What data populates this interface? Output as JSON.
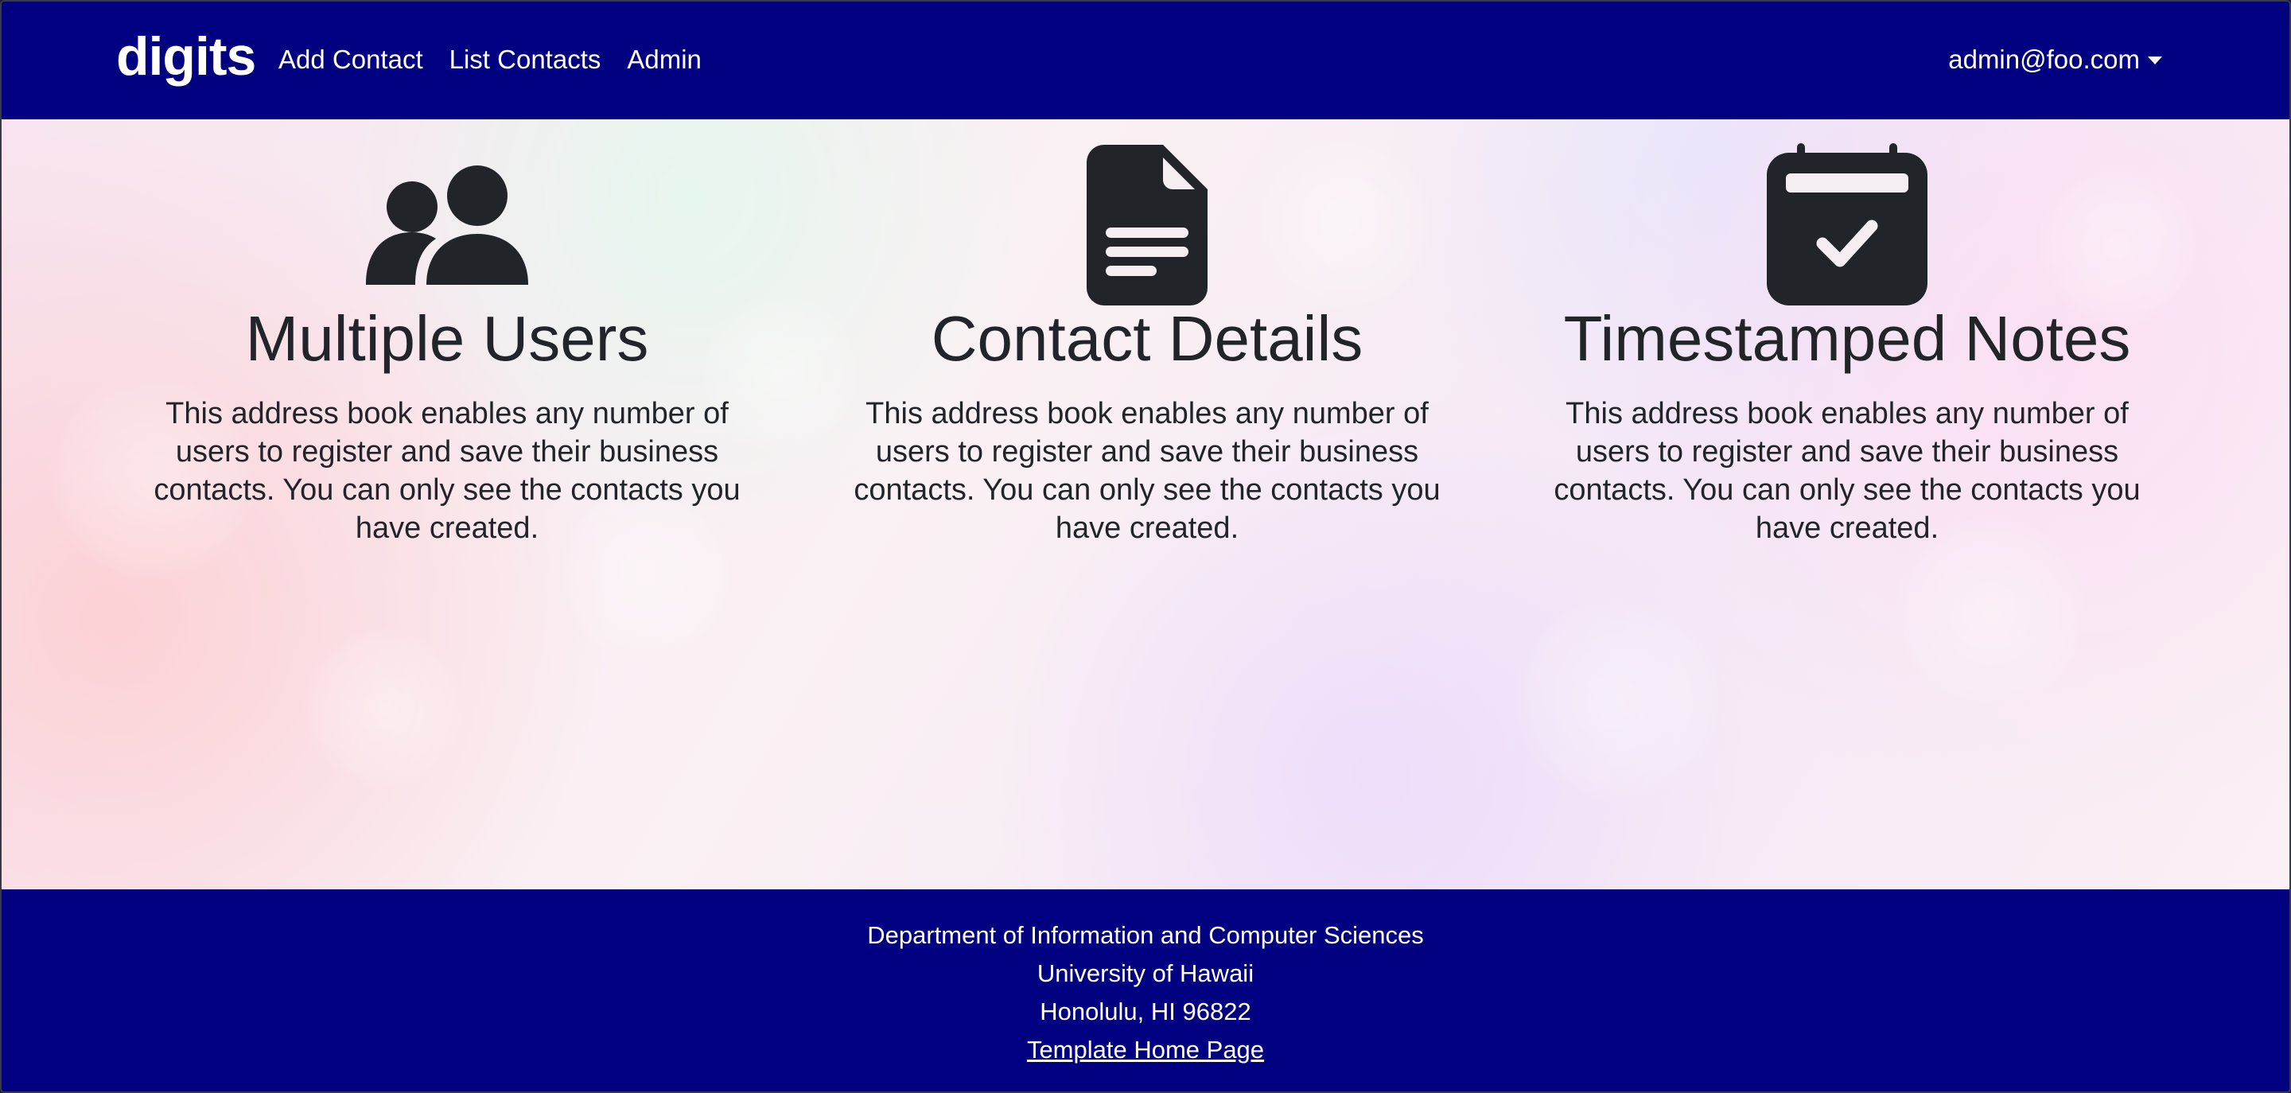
{
  "navbar": {
    "brand": "digits",
    "links": [
      "Add Contact",
      "List Contacts",
      "Admin"
    ],
    "user": "admin@foo.com"
  },
  "features": [
    {
      "icon": "users-icon",
      "title": "Multiple Users",
      "text": "This address book enables any number of users to register and save their business contacts. You can only see the contacts you have created."
    },
    {
      "icon": "file-icon",
      "title": "Contact Details",
      "text": "This address book enables any number of users to register and save their business contacts. You can only see the contacts you have created."
    },
    {
      "icon": "calendar-check-icon",
      "title": "Timestamped Notes",
      "text": "This address book enables any number of users to register and save their business contacts. You can only see the contacts you have created."
    }
  ],
  "footer": {
    "lines": [
      "Department of Information and Computer Sciences",
      "University of Hawaii",
      "Honolulu, HI 96822"
    ],
    "link": "Template Home Page"
  },
  "colors": {
    "navbar": "#000080",
    "footer": "#000080",
    "text": "#212529"
  }
}
